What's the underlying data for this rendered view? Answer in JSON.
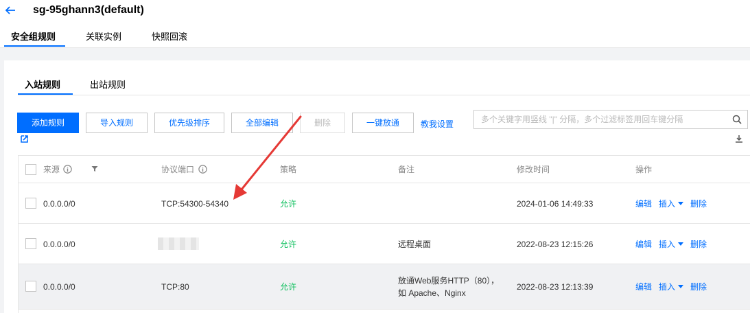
{
  "header": {
    "title": "sg-95ghann3(default)",
    "tabs": [
      {
        "label": "安全组规则"
      },
      {
        "label": "关联实例"
      },
      {
        "label": "快照回滚"
      }
    ]
  },
  "rules": {
    "tabs": [
      {
        "label": "入站规则"
      },
      {
        "label": "出站规则"
      }
    ],
    "toolbar": {
      "add_label": "添加规则",
      "import_label": "导入规则",
      "priority_label": "优先级排序",
      "edit_all_label": "全部编辑",
      "delete_label": "删除",
      "open_all_label": "一键放通",
      "help_label": "教我设置",
      "search_placeholder": "多个关键字用竖线 \"|\" 分隔，多个过滤标签用回车键分隔"
    },
    "columns": {
      "source": "来源",
      "protocol_port": "协议端口",
      "policy": "策略",
      "remark": "备注",
      "modified": "修改时间",
      "actions": "操作"
    },
    "action_labels": {
      "edit": "编辑",
      "insert": "插入",
      "delete": "删除"
    },
    "rows": [
      {
        "source": "0.0.0.0/0",
        "protocol_port": "TCP:54300-54340",
        "policy": "允许",
        "remark": "",
        "modified": "2024-01-06 14:49:33"
      },
      {
        "source": "0.0.0.0/0",
        "protocol_port": "",
        "policy": "允许",
        "remark": "远程桌面",
        "modified": "2022-08-23 12:15:26"
      },
      {
        "source": "0.0.0.0/0",
        "protocol_port": "TCP:80",
        "policy": "允许",
        "remark_line1": "放通Web服务HTTP（80），",
        "remark_line2": "如 Apache、Nginx",
        "modified": "2022-08-23 12:13:39"
      }
    ]
  },
  "colors": {
    "accent": "#006eff",
    "allow": "#0abf5b",
    "annotation_arrow": "#e53935"
  }
}
